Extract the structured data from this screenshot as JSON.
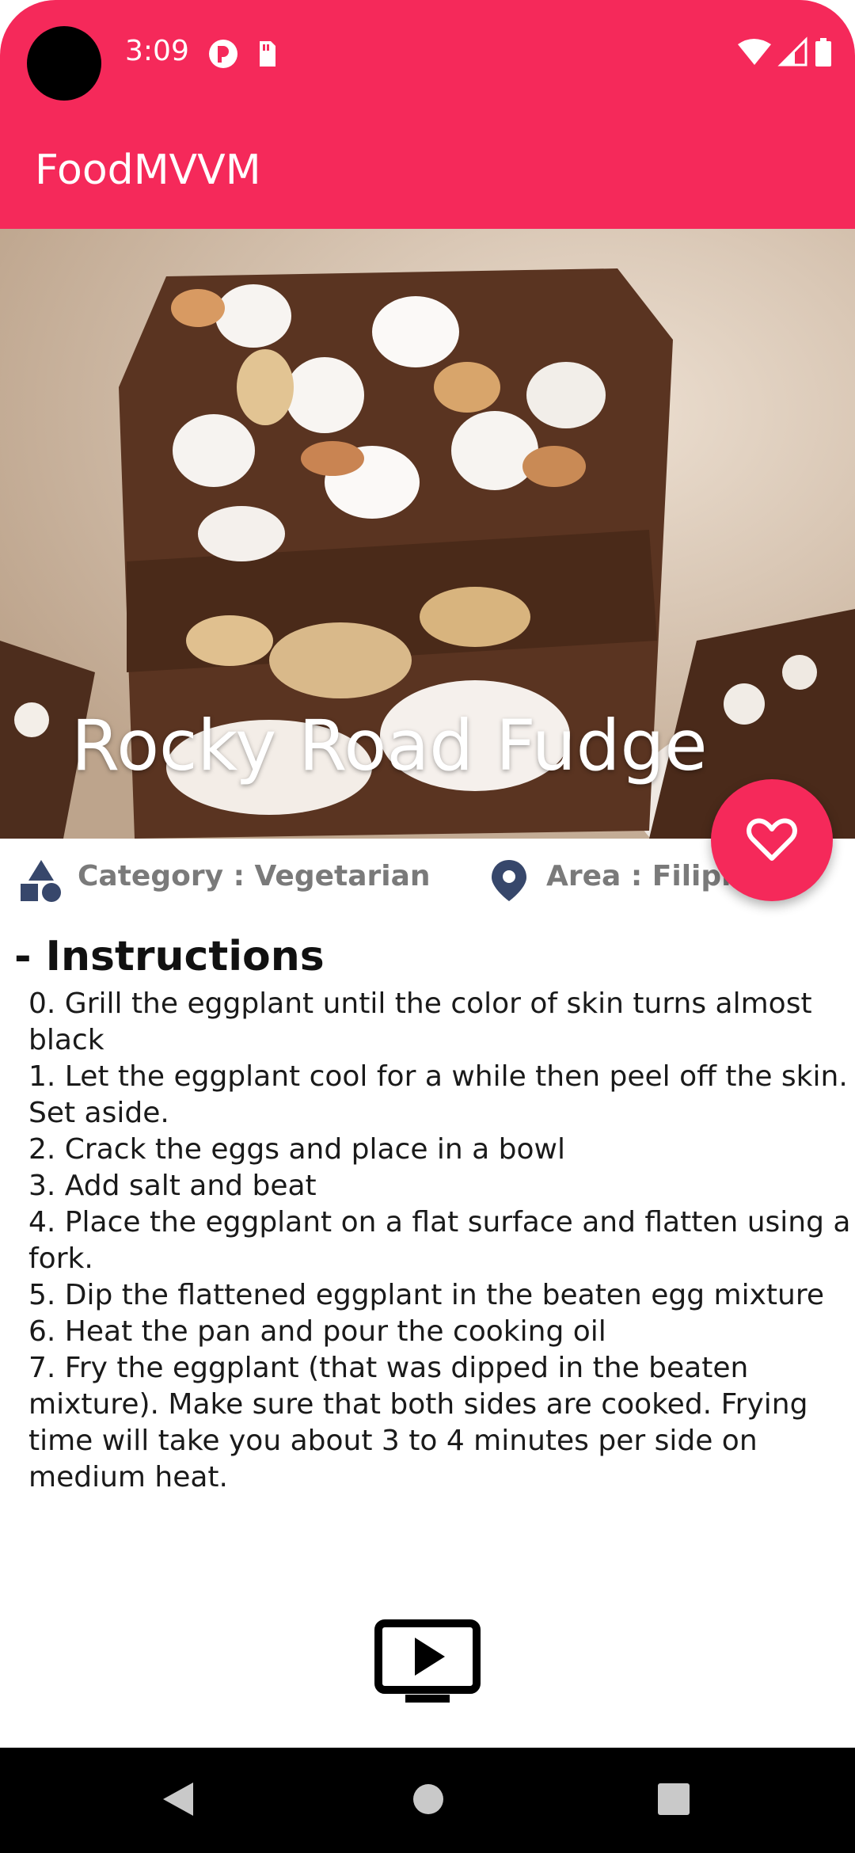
{
  "status_bar": {
    "time": "3:09",
    "left_icons": [
      "notification-icon",
      "sd-card-icon"
    ],
    "right_icons": [
      "wifi-icon",
      "signal-icon",
      "battery-icon"
    ]
  },
  "toolbar": {
    "title": "FoodMVVM"
  },
  "meal": {
    "name": "Rocky Road Fudge",
    "category": "Category : Vegetarian",
    "area": "Area : Filipino"
  },
  "instructions": {
    "heading": "- Instructions",
    "body": "0. Grill the eggplant until the color of skin turns almost black\n1. Let the eggplant cool for a while then peel off the skin. Set aside.\n2. Crack the eggs and place in a bowl\n3. Add salt and beat\n4. Place the eggplant on a flat surface and flatten using a fork.\n5. Dip the flattened eggplant in the beaten egg mixture\n6. Heat the pan and pour the cooking oil\n7. Fry the eggplant (that was dipped in the beaten mixture). Make sure that both sides are cooked. Frying time will take you about 3 to 4 minutes per side on medium heat."
  },
  "icons": {
    "favorite": "heart-outline-icon",
    "category": "category-shapes-icon",
    "area": "location-pin-icon",
    "video": "youtube-tv-icon"
  },
  "colors": {
    "primary": "#f5295a",
    "info_text": "#7a7a7a",
    "icon_dark": "#37476b"
  }
}
